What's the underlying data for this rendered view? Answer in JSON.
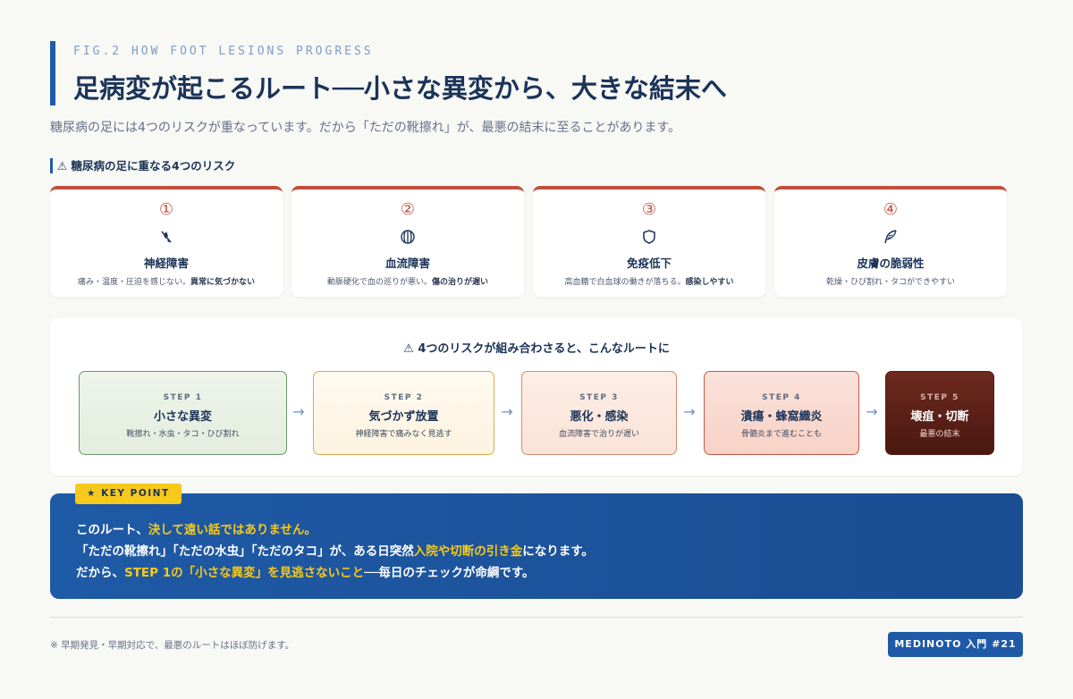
{
  "header": {
    "fig_label": "FIG.2 HOW FOOT LESIONS PROGRESS",
    "title": "足病変が起こるルート──小さな異変から、大きな結末へ",
    "subtitle": "糖尿病の足には4つのリスクが重なっています。だから「ただの靴擦れ」が、最悪の結末に至ることがあります。"
  },
  "risks": {
    "heading": "⚠ 糖尿病の足に重なる4つのリスク",
    "accent_color": "#c0503e",
    "items": [
      {
        "num": "①",
        "icon": "nerve-icon",
        "title": "神経障害",
        "desc": "痛み・温度・圧迫を感じない。",
        "desc_bold": "異常に気づかない"
      },
      {
        "num": "②",
        "icon": "blood-flow-icon",
        "title": "血流障害",
        "desc": "動脈硬化で血の巡りが悪い。",
        "desc_bold": "傷の治りが遅い"
      },
      {
        "num": "③",
        "icon": "shield-icon",
        "title": "免疫低下",
        "desc": "高血糖で白血球の働きが落ちる。",
        "desc_bold": "感染しやすい"
      },
      {
        "num": "④",
        "icon": "feather-icon",
        "title": "皮膚の脆弱性",
        "desc": "乾燥・ひび割れ・タコができやすい",
        "desc_bold": ""
      }
    ]
  },
  "route": {
    "title": "⚠ 4つのリスクが組み合わさると、こんなルートに",
    "arrow": "→",
    "steps": [
      {
        "label": "STEP 1",
        "title": "小さな異変",
        "desc": "靴擦れ・水虫・タコ・ひび割れ",
        "color": "#6b9a6a"
      },
      {
        "label": "STEP 2",
        "title": "気づかず放置",
        "desc": "神経障害で痛みなく見逃す",
        "color": "#d9a850"
      },
      {
        "label": "STEP 3",
        "title": "悪化・感染",
        "desc": "血流障害で治りが遅い",
        "color": "#d98a70"
      },
      {
        "label": "STEP 4",
        "title": "潰瘍・蜂窩織炎",
        "desc": "骨髄炎まで進むことも",
        "color": "#c85a48"
      },
      {
        "label": "STEP 5",
        "title": "壊疽・切断",
        "desc": "最悪の結末",
        "color": "#5a1e16"
      }
    ]
  },
  "key_point": {
    "badge": "★ KEY POINT",
    "line1_a": "このルート、",
    "line1_hl": "決して遠い話ではありません。",
    "line2_a": "「ただの靴擦れ」「ただの水虫」「ただのタコ」が、ある日突然",
    "line2_hl": "入院や切断の引き金",
    "line2_b": "になります。",
    "line3_a": "だから、",
    "line3_hl": "STEP 1の「小さな異変」を見逃さないこと",
    "line3_b": "──毎日のチェックが命綱です。",
    "highlight_color": "#f7c91a"
  },
  "footer": {
    "note": "※ 早期発見・早期対応で、最悪のルートはほぼ防げます。",
    "brand": "MEDINOTO 入門 #21"
  }
}
